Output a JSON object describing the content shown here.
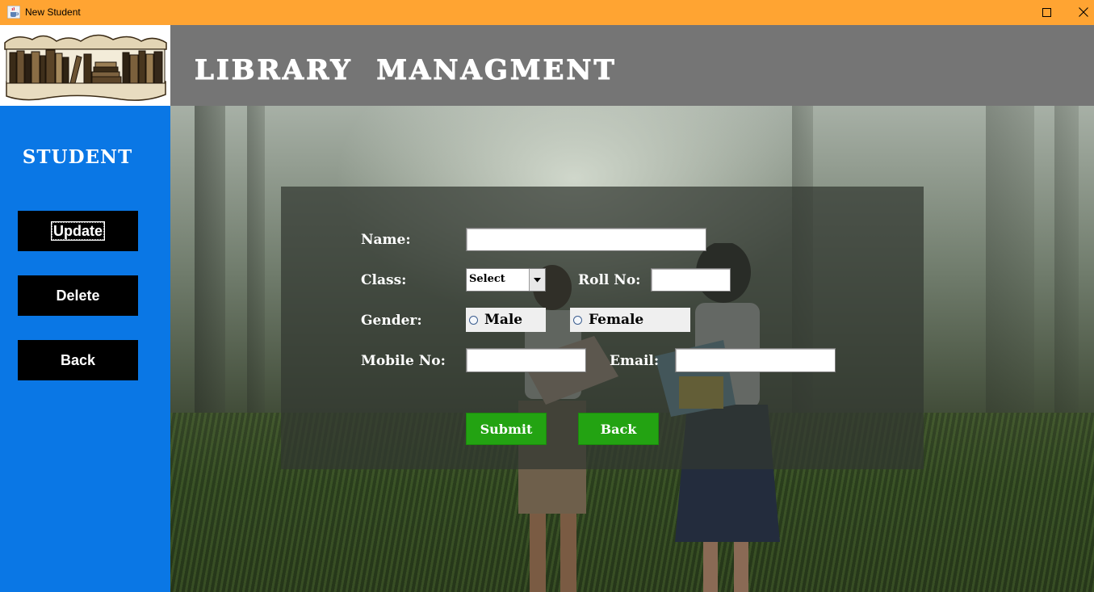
{
  "window": {
    "title": "New Student",
    "maximize_glyph": "☐",
    "close_glyph": "✕",
    "icon": "java-cup-icon"
  },
  "header": {
    "app_title": "LIBRARY  MANAGMENT",
    "logo": "bookshelf-logo"
  },
  "sidebar": {
    "title": "STUDENT",
    "buttons": [
      {
        "label": "Update"
      },
      {
        "label": "Delete"
      },
      {
        "label": "Back"
      }
    ]
  },
  "form": {
    "name_label": "Name:",
    "name_value": "",
    "class_label": "Class:",
    "class_selected": "Select",
    "roll_label": "Roll No:",
    "roll_value": "",
    "gender_label": "Gender:",
    "gender_options": [
      "Male",
      "Female"
    ],
    "mobile_label": "Mobile No:",
    "mobile_value": "",
    "email_label": "Email:",
    "email_value": "",
    "submit_label": "Submit",
    "back_label": "Back"
  },
  "colors": {
    "titlebar": "#FFA432",
    "header": "#757575",
    "sidebar": "#0A77E5",
    "action_button": "#23A312",
    "sidebar_button": "#000000"
  }
}
